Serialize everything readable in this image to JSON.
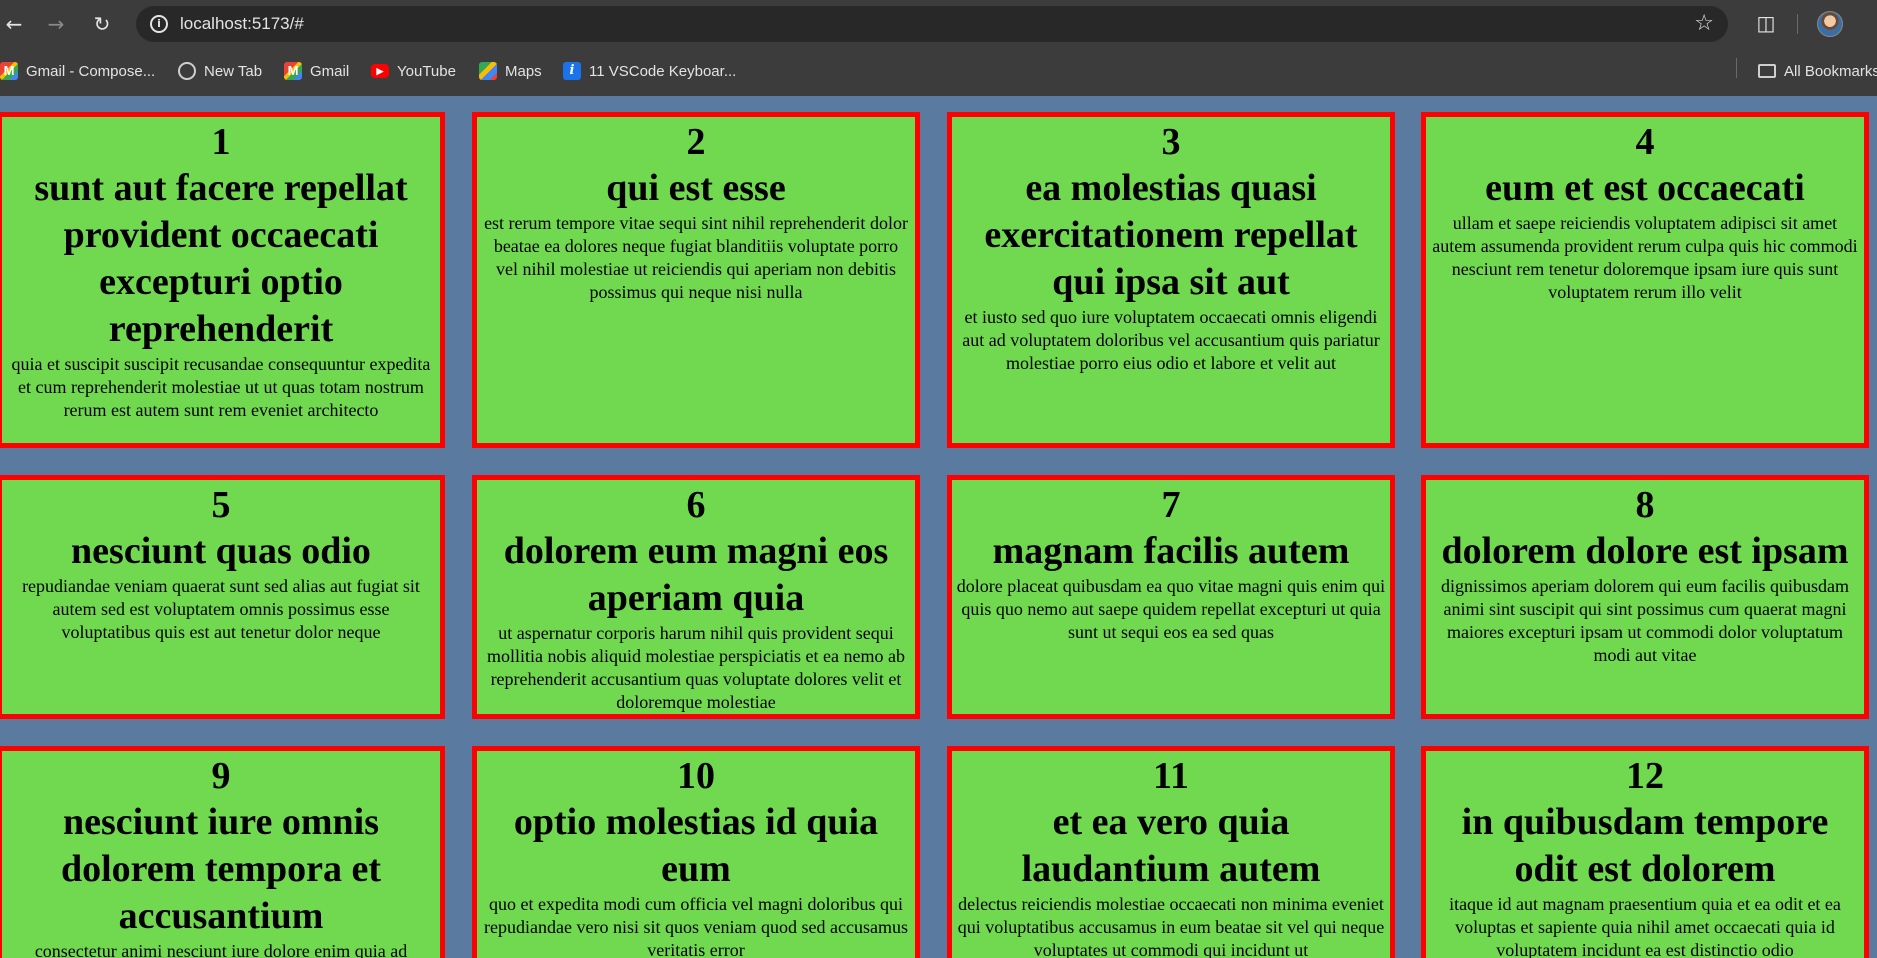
{
  "browser": {
    "url": "localhost:5173/#",
    "bookmarks": [
      {
        "label": "Gmail - Compose...",
        "icon": "gmail-icon"
      },
      {
        "label": "New Tab",
        "icon": "globe-icon"
      },
      {
        "label": "Gmail",
        "icon": "gmail-icon"
      },
      {
        "label": "YouTube",
        "icon": "youtube-icon"
      },
      {
        "label": "Maps",
        "icon": "maps-icon"
      },
      {
        "label": "11 VSCode Keyboar...",
        "icon": "info-icon"
      }
    ],
    "all_bookmarks_label": "All Bookmarks"
  },
  "colors": {
    "page_background": "#5b7aa0",
    "card_background": "#70d94f",
    "card_border": "#ff0000"
  },
  "posts": [
    {
      "id": "1",
      "title": "sunt aut facere repellat provident occaecati excepturi optio reprehenderit",
      "body": "quia et suscipit suscipit recusandae consequuntur expedita et cum reprehenderit molestiae ut ut quas totam nostrum rerum est autem sunt rem eveniet architecto"
    },
    {
      "id": "2",
      "title": "qui est esse",
      "body": "est rerum tempore vitae sequi sint nihil reprehenderit dolor beatae ea dolores neque fugiat blanditiis voluptate porro vel nihil molestiae ut reiciendis qui aperiam non debitis possimus qui neque nisi nulla"
    },
    {
      "id": "3",
      "title": "ea molestias quasi exercitationem repellat qui ipsa sit aut",
      "body": "et iusto sed quo iure voluptatem occaecati omnis eligendi aut ad voluptatem doloribus vel accusantium quis pariatur molestiae porro eius odio et labore et velit aut"
    },
    {
      "id": "4",
      "title": "eum et est occaecati",
      "body": "ullam et saepe reiciendis voluptatem adipisci sit amet autem assumenda provident rerum culpa quis hic commodi nesciunt rem tenetur doloremque ipsam iure quis sunt voluptatem rerum illo velit"
    },
    {
      "id": "5",
      "title": "nesciunt quas odio",
      "body": "repudiandae veniam quaerat sunt sed alias aut fugiat sit autem sed est voluptatem omnis possimus esse voluptatibus quis est aut tenetur dolor neque"
    },
    {
      "id": "6",
      "title": "dolorem eum magni eos aperiam quia",
      "body": "ut aspernatur corporis harum nihil quis provident sequi mollitia nobis aliquid molestiae perspiciatis et ea nemo ab reprehenderit accusantium quas voluptate dolores velit et doloremque molestiae"
    },
    {
      "id": "7",
      "title": "magnam facilis autem",
      "body": "dolore placeat quibusdam ea quo vitae magni quis enim qui quis quo nemo aut saepe quidem repellat excepturi ut quia sunt ut sequi eos ea sed quas"
    },
    {
      "id": "8",
      "title": "dolorem dolore est ipsam",
      "body": "dignissimos aperiam dolorem qui eum facilis quibusdam animi sint suscipit qui sint possimus cum quaerat magni maiores excepturi ipsam ut commodi dolor voluptatum modi aut vitae"
    },
    {
      "id": "9",
      "title": "nesciunt iure omnis dolorem tempora et accusantium",
      "body": "consectetur animi nesciunt iure dolore enim quia ad"
    },
    {
      "id": "10",
      "title": "optio molestias id quia eum",
      "body": "quo et expedita modi cum officia vel magni doloribus qui repudiandae vero nisi sit quos veniam quod sed accusamus veritatis error"
    },
    {
      "id": "11",
      "title": "et ea vero quia laudantium autem",
      "body": "delectus reiciendis molestiae occaecati non minima eveniet qui voluptatibus accusamus in eum beatae sit vel qui neque voluptates ut commodi qui incidunt ut"
    },
    {
      "id": "12",
      "title": "in quibusdam tempore odit est dolorem",
      "body": "itaque id aut magnam praesentium quia et ea odit et ea voluptas et sapiente quia nihil amet occaecati quia id voluptatem incidunt ea est distinctio odio"
    }
  ]
}
